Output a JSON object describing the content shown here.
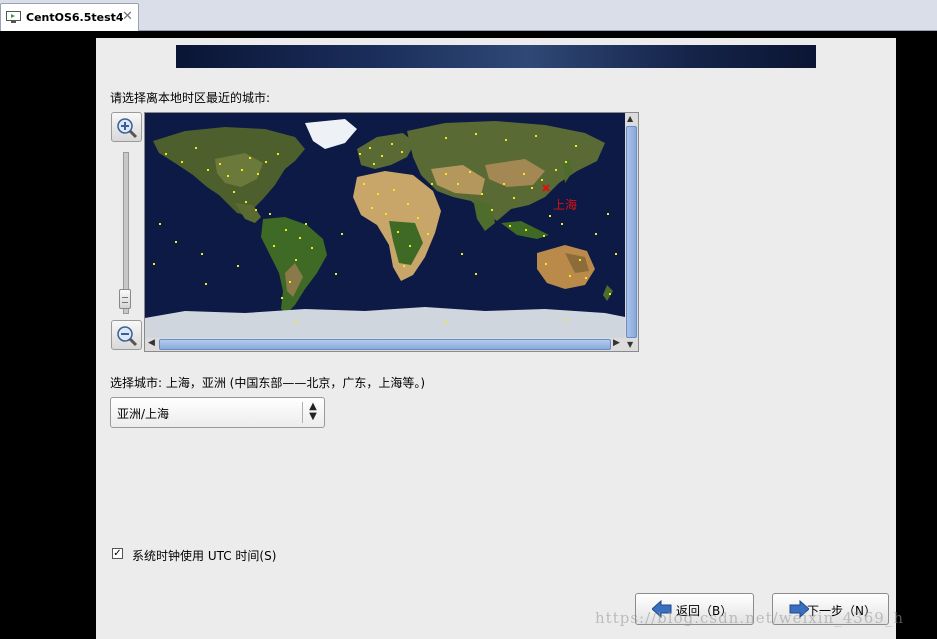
{
  "tab": {
    "title": "CentOS6.5test4",
    "icon": "vm-icon",
    "close_icon": "close-icon"
  },
  "installer": {
    "instruction": "请选择离本地时区最近的城市:",
    "map": {
      "selected_city_label": "上海",
      "marker_color": "#e01010",
      "city_dot_color": "#f2ea1a"
    },
    "selected_city_text": "选择城市: 上海，亚洲 (中国东部——北京，广东，上海等。)",
    "timezone_select": {
      "value": "亚洲/上海"
    },
    "utc_checkbox": {
      "label": "系统时钟使用 UTC 时间(S)",
      "checked": true,
      "mark": "✓"
    },
    "buttons": {
      "back_label": "返回（B）",
      "next_label": "下一步（N）"
    }
  },
  "watermark": "https://blog.csdn.net/weixin_4369_h"
}
